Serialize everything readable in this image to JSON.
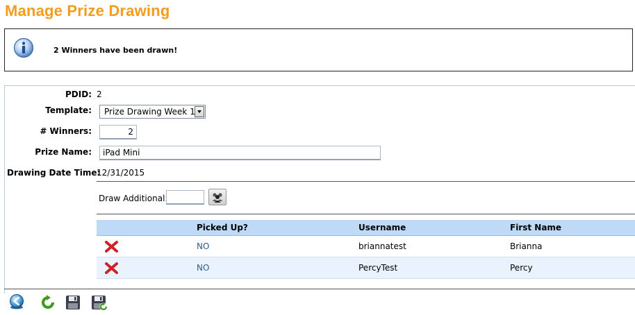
{
  "page": {
    "title": "Manage Prize Drawing"
  },
  "info": {
    "message": "2 Winners have been drawn!",
    "icon": "info-icon"
  },
  "form": {
    "pdid": {
      "label": "PDID:",
      "value": "2"
    },
    "template": {
      "label": "Template:",
      "value": "Prize Drawing Week 1"
    },
    "winners": {
      "label": "# Winners:",
      "value": "2"
    },
    "prize_name": {
      "label": "Prize Name:",
      "value": "iPad Mini"
    },
    "drawing_date_time": {
      "label": "Drawing Date Time:",
      "value": "12/31/2015"
    },
    "draw_additional": {
      "label": "Draw Additional:",
      "value": ""
    }
  },
  "winners_table": {
    "columns": [
      "",
      "Picked Up?",
      "Username",
      "First Name"
    ],
    "rows": [
      {
        "picked_up": "NO",
        "username": "briannatest",
        "first_name": "Brianna"
      },
      {
        "picked_up": "NO",
        "username": "PercyTest",
        "first_name": "Percy"
      }
    ]
  },
  "toolbar": {
    "icons": [
      "back-icon",
      "refresh-icon",
      "save-icon",
      "save-and-close-icon"
    ]
  },
  "colors": {
    "title": "#f59c1a",
    "header_bg": "#bfdaf7",
    "alt_row_bg": "#eaf3fd",
    "delete_red": "#d0202a",
    "link_blue": "#2b5c8f",
    "refresh_green": "#3e9a1f"
  }
}
